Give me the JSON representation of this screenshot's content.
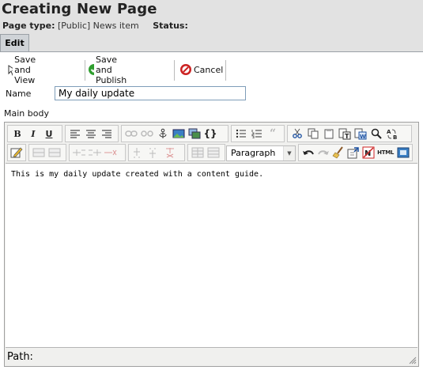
{
  "page": {
    "title": "Creating New Page",
    "page_type_label": "Page type:",
    "page_type_value": "[Public] News item",
    "status_label": "Status:"
  },
  "tabs": [
    {
      "label": "Edit"
    }
  ],
  "actions": {
    "save_view": "Save and View",
    "save_publish": "Save and Publish",
    "cancel": "Cancel"
  },
  "form": {
    "name_label": "Name",
    "name_value": "My daily update",
    "main_body_label": "Main body"
  },
  "editor": {
    "format_select": "Paragraph",
    "content": "This is my daily update created with a content guide.",
    "path_label": "Path:",
    "html_button": "HTML",
    "bold": "B",
    "italic": "I",
    "underline": "U",
    "code": "{}",
    "quote": "“"
  },
  "colors": {
    "header_bg": "#e2e2e2",
    "tab_bg": "#cfd3d7",
    "save_publish": "#2e9e2e",
    "cancel": "#cc2222"
  }
}
